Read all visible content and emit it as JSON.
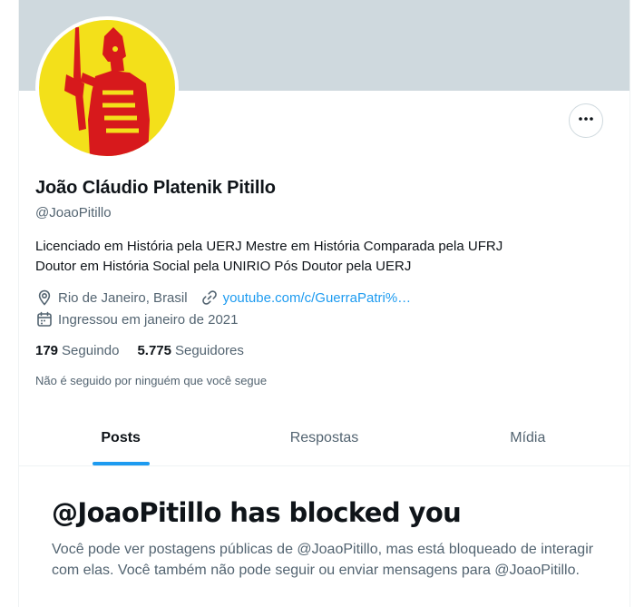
{
  "profile": {
    "name": "João Cláudio Platenik Pitillo",
    "handle": "@JoaoPitillo",
    "bio_line1": "Licenciado em História pela UERJ Mestre em História Comparada pela UFRJ",
    "bio_line2": "Doutor em História Social pela UNIRIO Pós Doutor pela UERJ",
    "location": "Rio de Janeiro, Brasil",
    "website": "youtube.com/c/GuerraPatri%…",
    "joined": "Ingressou em janeiro de 2021",
    "following_count": "179",
    "following_label": "Seguindo",
    "followers_count": "5.775",
    "followers_label": "Seguidores",
    "mutual_text": "Não é seguido por ninguém que você segue"
  },
  "tabs": [
    {
      "label": "Posts",
      "active": true
    },
    {
      "label": "Respostas",
      "active": false
    },
    {
      "label": "Mídia",
      "active": false
    }
  ],
  "blocked": {
    "title": "@JoaoPitillo has blocked you",
    "message": "Você pode ver postagens públicas de @JoaoPitillo, mas está bloqueado de interagir com elas. Você também não pode seguir ou enviar mensagens para @JoaoPitillo."
  },
  "icons": {
    "more": "more-horizontal-icon",
    "location": "location-pin-icon",
    "link": "link-icon",
    "calendar": "calendar-icon"
  },
  "colors": {
    "accent": "#1d9bf0",
    "banner": "#cfd9de",
    "avatar_bg": "#f3e01a",
    "avatar_figure": "#d7191c"
  }
}
